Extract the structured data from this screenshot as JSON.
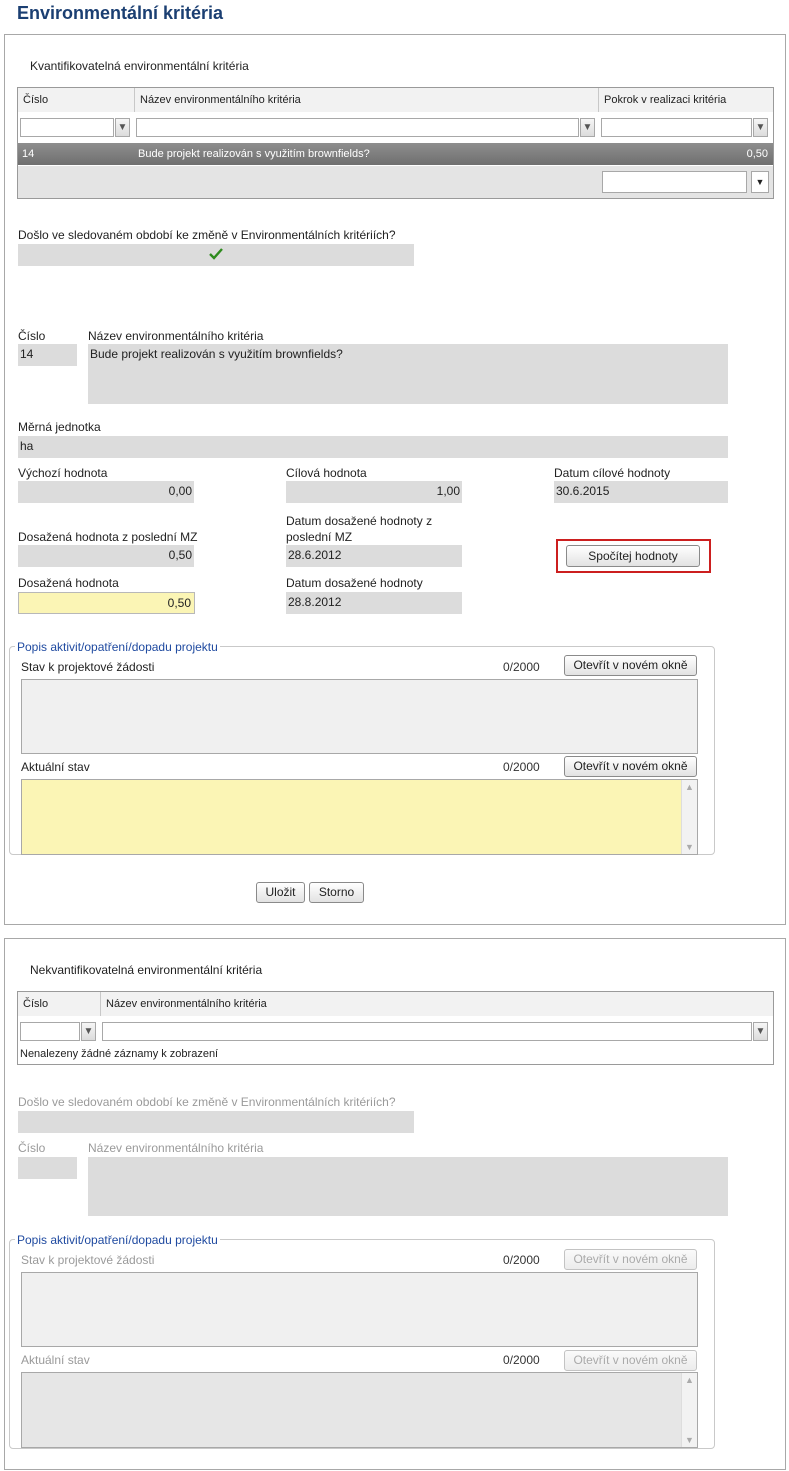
{
  "page": {
    "title": "Environmentální kritéria"
  },
  "quant": {
    "caption": "Kvantifikovatelná environmentální kritéria",
    "columns": {
      "cislo": "Číslo",
      "nazev": "Název environmentálního kritéria",
      "pokrok": "Pokrok v realizaci kritéria"
    },
    "row": {
      "cislo": "14",
      "nazev": "Bude projekt realizován s využitím brownfields?",
      "pokrok": "0,50"
    },
    "change_question": "Došlo ve sledovaném období ke změně v Environmentálních kritériích?",
    "detail": {
      "cislo_label": "Číslo",
      "cislo_value": "14",
      "nazev_label": "Název environmentálního kritéria",
      "nazev_value": "Bude projekt realizován s využitím brownfields?",
      "jednotka_label": "Měrná jednotka",
      "jednotka_value": "ha",
      "vychozi_label": "Výchozí hodnota",
      "vychozi_value": "0,00",
      "cilova_label": "Cílová hodnota",
      "cilova_value": "1,00",
      "datum_cilove_label": "Datum cílové hodnoty",
      "datum_cilove_value": "30.6.2015",
      "dosazena_mz_label": "Dosažená hodnota z poslední MZ",
      "dosazena_mz_value": "0,50",
      "datum_dosazene_mz_label": "Datum dosažené hodnoty z poslední MZ",
      "datum_dosazene_mz_value": "28.6.2012",
      "spocitej_button": "Spočítej hodnoty",
      "dosazena_label": "Dosažená hodnota",
      "dosazena_value": "0,50",
      "datum_dosazene_label": "Datum dosažené hodnoty",
      "datum_dosazene_value": "28.8.2012"
    },
    "popis": {
      "legend": "Popis aktivit/opatření/dopadu projektu",
      "stav_label": "Stav k projektové žádosti",
      "stav_counter": "0/2000",
      "aktualni_label": "Aktuální stav",
      "aktualni_counter": "0/2000",
      "open_button": "Otevřít v novém okně"
    },
    "save_button": "Uložit",
    "cancel_button": "Storno"
  },
  "nonquant": {
    "caption": "Nekvantifikovatelná environmentální kritéria",
    "columns": {
      "cislo": "Číslo",
      "nazev": "Název environmentálního kritéria"
    },
    "empty_text": "Nenalezeny žádné záznamy k zobrazení",
    "change_question": "Došlo ve sledovaném období ke změně v Environmentálních kritériích?",
    "cislo_label": "Číslo",
    "nazev_label": "Název environmentálního kritéria",
    "popis": {
      "legend": "Popis aktivit/opatření/dopadu projektu",
      "stav_label": "Stav k projektové žádosti",
      "stav_counter": "0/2000",
      "aktualni_label": "Aktuální stav",
      "aktualni_counter": "0/2000",
      "open_button": "Otevřít v novém okně"
    }
  },
  "colors": {
    "title": "#1b3f72",
    "legend": "#1f4aa0",
    "highlight": "#cc1f1f",
    "editable": "#fbf5b5",
    "readonly": "#dcdcdc"
  }
}
